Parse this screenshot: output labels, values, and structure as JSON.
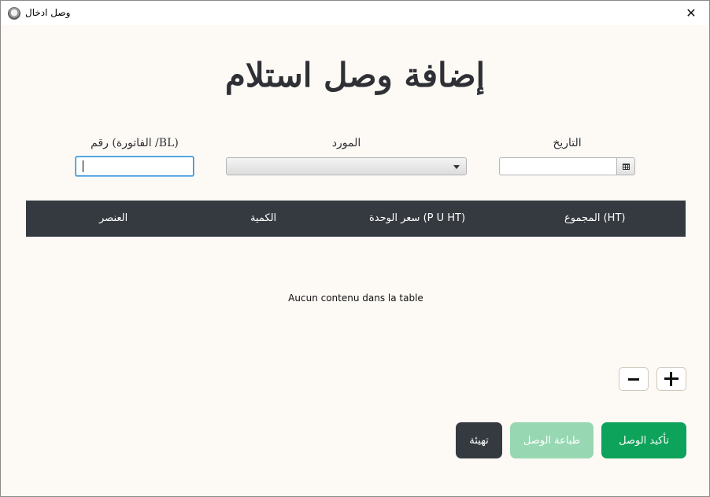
{
  "window": {
    "title": "وصل ادخال",
    "close_icon": "✕"
  },
  "heading": "إضافة وصل استلام",
  "form": {
    "invoice_label": "رقم (الفاتورة /BL)",
    "invoice_value": "",
    "supplier_label": "المورد",
    "supplier_value": "",
    "date_label": "التاريخ",
    "date_value": ""
  },
  "table": {
    "columns": [
      "العنصر",
      "الكمية",
      "سعر الوحدة (P U HT)",
      "المجموع (HT)"
    ],
    "rows": [],
    "empty_message": "Aucun contenu dans la table"
  },
  "buttons": {
    "remove_row": "minus-icon",
    "add_row": "plus-icon",
    "reset": "تهيئة",
    "print": "طباعة الوصل",
    "confirm": "تأكيد الوصل"
  },
  "colors": {
    "table_header": "#353a40",
    "confirm": "#0ea35a",
    "print": "#97d8b3",
    "reset": "#353a40",
    "focus": "#2b8fd6"
  }
}
